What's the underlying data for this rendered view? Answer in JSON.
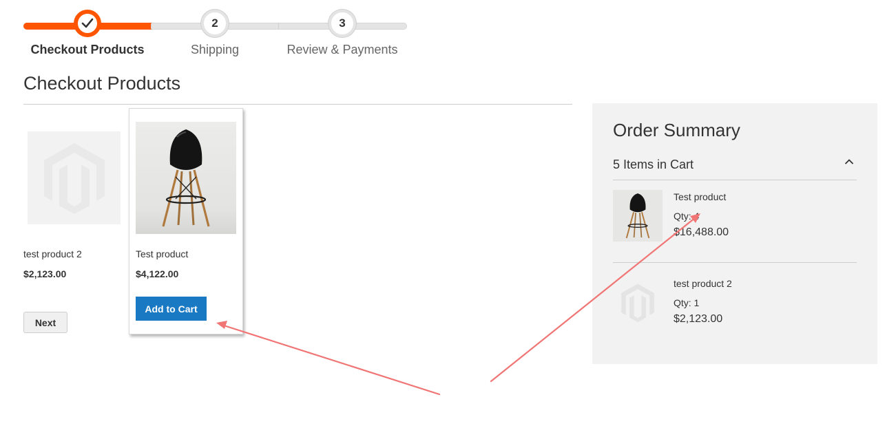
{
  "progress": {
    "steps": [
      {
        "number": "",
        "label": "Checkout Products",
        "state": "complete"
      },
      {
        "number": "2",
        "label": "Shipping",
        "state": "pending"
      },
      {
        "number": "3",
        "label": "Review & Payments",
        "state": "pending"
      }
    ],
    "accent_color": "#ff5501"
  },
  "main": {
    "title": "Checkout Products",
    "products": [
      {
        "name": "test product 2",
        "price": "$2,123.00",
        "image": "magento-placeholder-icon"
      },
      {
        "name": "Test product",
        "price": "$4,122.00",
        "image": "black-chair-photo",
        "action_label": "Add to Cart"
      }
    ],
    "next_label": "Next"
  },
  "summary": {
    "title": "Order Summary",
    "items_count_label": "5 Items in Cart",
    "items": [
      {
        "name": "Test product",
        "qty": "Qty: 4",
        "price": "$16,488.00",
        "image": "black-chair-photo"
      },
      {
        "name": "test product 2",
        "qty": "Qty: 1",
        "price": "$2,123.00",
        "image": "magento-placeholder-icon"
      }
    ]
  },
  "colors": {
    "primary_button": "#1979c3",
    "annotation_arrow": "#f07574",
    "summary_background": "#f2f2f2"
  }
}
